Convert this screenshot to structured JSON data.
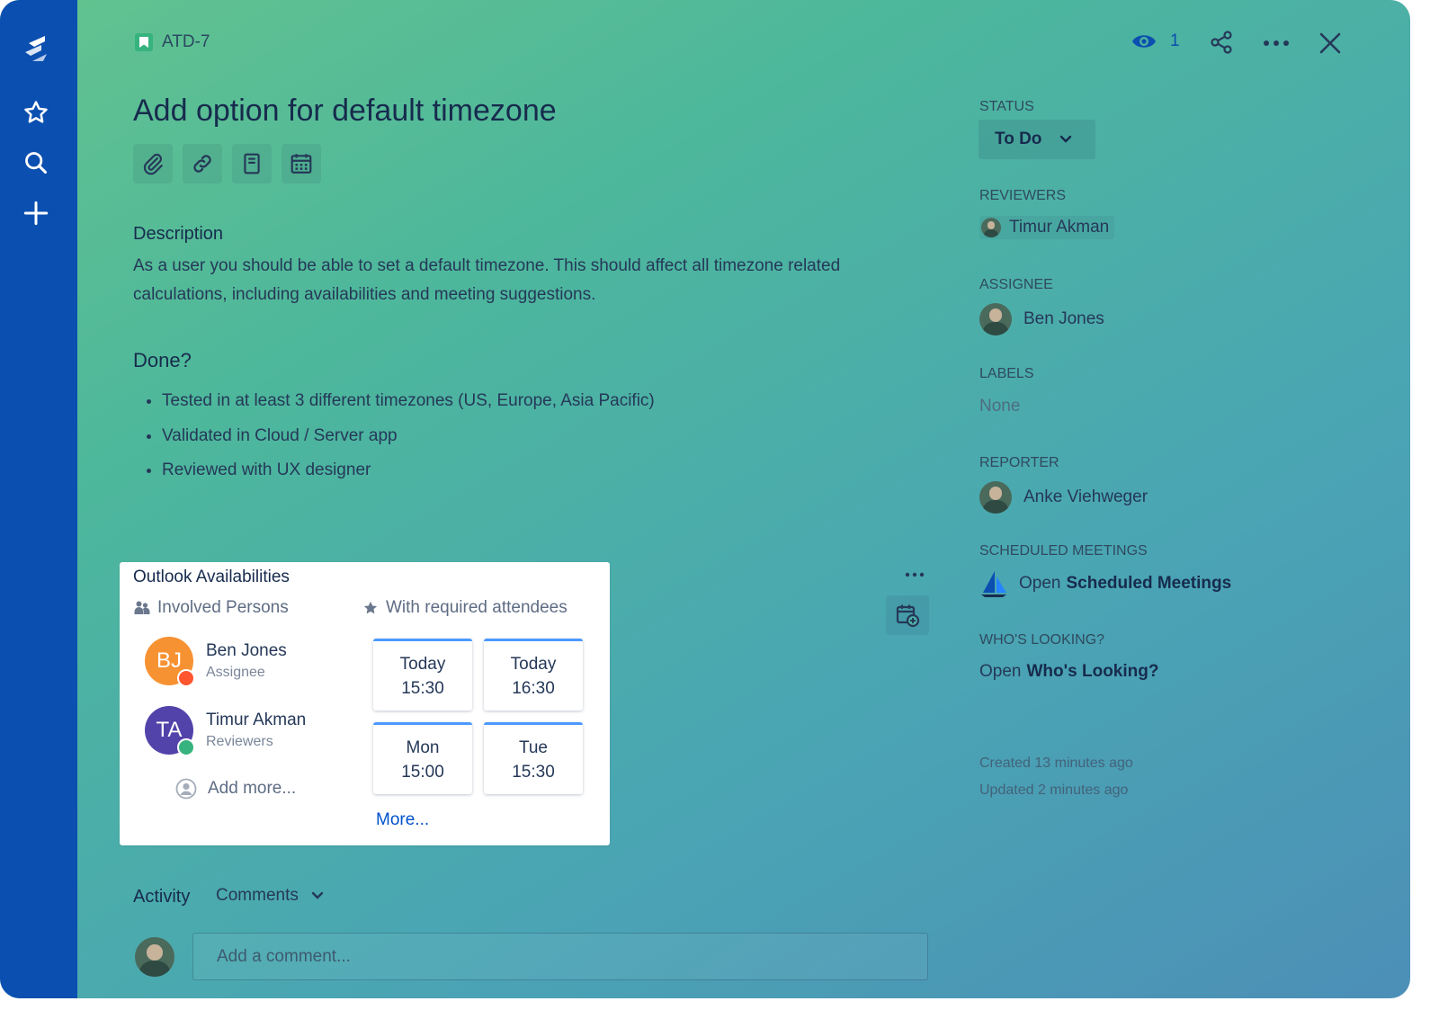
{
  "issue": {
    "key": "ATD-7",
    "title": "Add option for default timezone",
    "watchers": "1"
  },
  "description": {
    "label": "Description",
    "text": "As a user you should be able to set a default timezone. This should affect all timezone related calculations, including availabilities and meeting suggestions."
  },
  "done": {
    "label": "Done?",
    "items": [
      "Tested in at least 3 different timezones (US, Europe, Asia Pacific)",
      "Validated in Cloud / Server app",
      "Reviewed with UX designer"
    ]
  },
  "outlook": {
    "title": "Outlook Availabilities",
    "involved_label": "Involved Persons",
    "attendees_label": "With required attendees",
    "persons": [
      {
        "initials": "BJ",
        "name": "Ben Jones",
        "role": "Assignee",
        "color": "#f79232",
        "status": "busy"
      },
      {
        "initials": "TA",
        "name": "Timur Akman",
        "role": "Reviewers",
        "color": "#5243aa",
        "status": "available"
      }
    ],
    "add_more": "Add more...",
    "slots": [
      {
        "day": "Today",
        "time": "15:30"
      },
      {
        "day": "Today",
        "time": "16:30"
      },
      {
        "day": "Mon",
        "time": "15:00"
      },
      {
        "day": "Tue",
        "time": "15:30"
      }
    ],
    "more": "More..."
  },
  "activity": {
    "label": "Activity",
    "filter": "Comments",
    "comment_placeholder": "Add a comment..."
  },
  "sidebar_right": {
    "status_label": "Status",
    "status_value": "To Do",
    "reviewers_label": "Reviewers",
    "reviewer": "Timur Akman",
    "assignee_label": "Assignee",
    "assignee": "Ben Jones",
    "labels_label": "Labels",
    "labels_value": "None",
    "reporter_label": "Reporter",
    "reporter": "Anke Viehweger",
    "scheduled_label": "Scheduled Meetings",
    "scheduled_open": "Open",
    "scheduled_link": "Scheduled Meetings",
    "looking_label": "Who's Looking?",
    "looking_open": "Open",
    "looking_link": "Who's Looking?",
    "created": "Created 13 minutes ago",
    "updated": "Updated 2 minutes ago"
  },
  "colors": {
    "nav": "#0b4fb0",
    "accent": "#0052cc",
    "story": "#36b37e",
    "busy": "#ff5630",
    "available": "#36b37e"
  }
}
